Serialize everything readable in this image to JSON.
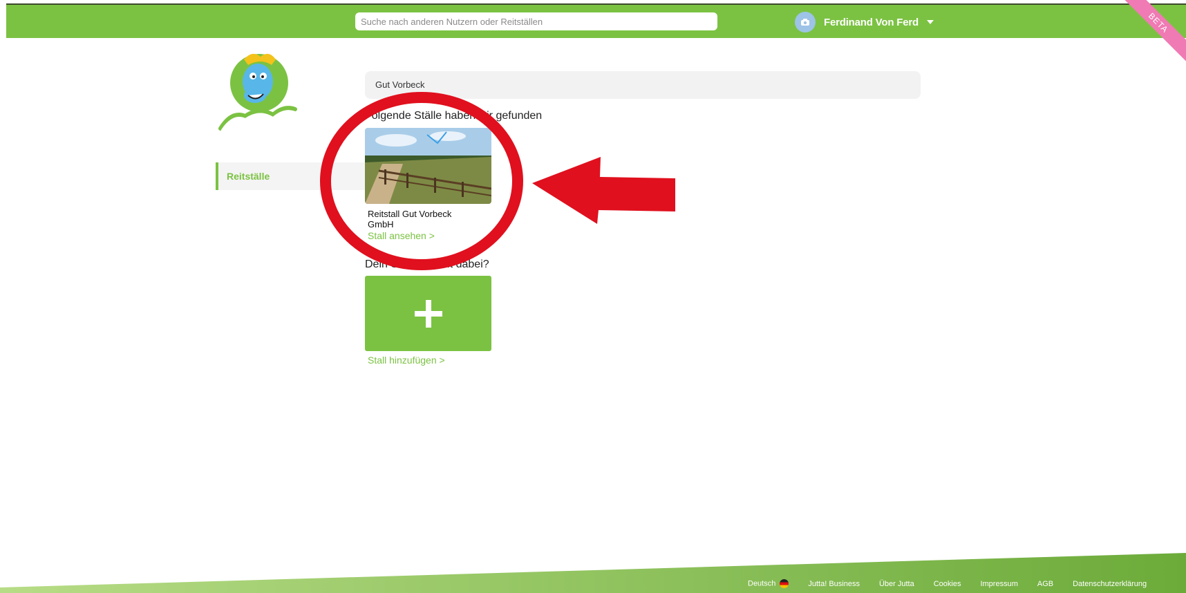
{
  "header": {
    "search_placeholder": "Suche nach anderen Nutzern oder Reitställen",
    "user_name": "Ferdinand Von Ferd",
    "beta_label": "BETA"
  },
  "sidebar": {
    "items": [
      {
        "label": "Reitställe"
      }
    ]
  },
  "main": {
    "query": "Gut Vorbeck",
    "found_heading": "Folgende Ställe haben wir gefunden",
    "results": [
      {
        "name": "Reitstall Gut Vorbeck GmbH",
        "link": "Stall ansehen >"
      }
    ],
    "missing_heading": "Dein Stall ist nicht dabei?",
    "add_link": "Stall hinzufügen >"
  },
  "footer": {
    "language": "Deutsch",
    "links": [
      "Jutta! Business",
      "Über Jutta",
      "Cookies",
      "Impressum",
      "AGB",
      "Datenschutzerklärung"
    ]
  },
  "colors": {
    "brand_green": "#7bc242",
    "annotation_red": "#e0101e",
    "beta_pink": "#f07ab3"
  }
}
